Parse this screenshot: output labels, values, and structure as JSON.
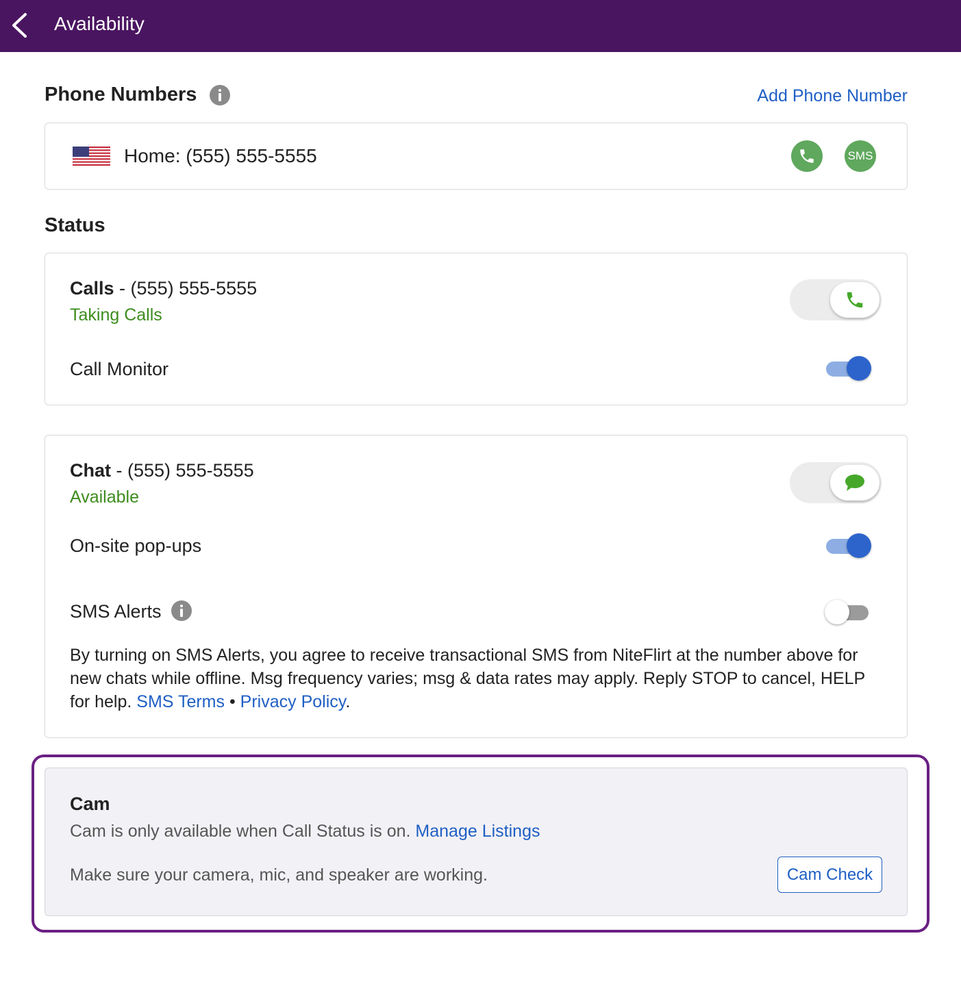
{
  "header": {
    "title": "Availability",
    "background": "#4a1560"
  },
  "phone_numbers": {
    "title": "Phone Numbers",
    "add_link": "Add Phone Number",
    "entry": {
      "flag": "us-flag-icon",
      "text": "Home: (555) 555-5555",
      "sms_badge": "SMS"
    }
  },
  "status": {
    "title": "Status",
    "calls": {
      "label": "Calls",
      "separator": " - ",
      "number": "(555) 555-5555",
      "state": "Taking Calls",
      "toggle_on": true,
      "call_monitor_label": "Call Monitor",
      "call_monitor_on": true
    },
    "chat": {
      "label": "Chat",
      "separator": " - ",
      "number": "(555) 555-5555",
      "state": "Available",
      "toggle_on": true,
      "popups_label": "On-site pop-ups",
      "popups_on": true,
      "sms_alerts_label": "SMS Alerts",
      "sms_alerts_on": false,
      "disclaimer": "By turning on SMS Alerts, you agree to receive transactional SMS from NiteFlirt at the number above for new chats while offline. Msg frequency varies; msg & data rates may apply. Reply STOP to cancel, HELP for help. ",
      "sms_terms_link": "SMS Terms",
      "bullet": " • ",
      "privacy_link": "Privacy Policy",
      "period": "."
    }
  },
  "cam": {
    "title": "Cam",
    "description": "Cam is only available when Call Status is on. ",
    "manage_link": "Manage Listings",
    "note": "Make sure your camera, mic, and speaker are working.",
    "check_button": "Cam Check"
  },
  "colors": {
    "accent_purple": "#4a1560",
    "link_blue": "#1f5fc4",
    "status_green": "#3d8c1e",
    "badge_green": "#5fa85d",
    "toggle_blue": "#2d64cc"
  }
}
